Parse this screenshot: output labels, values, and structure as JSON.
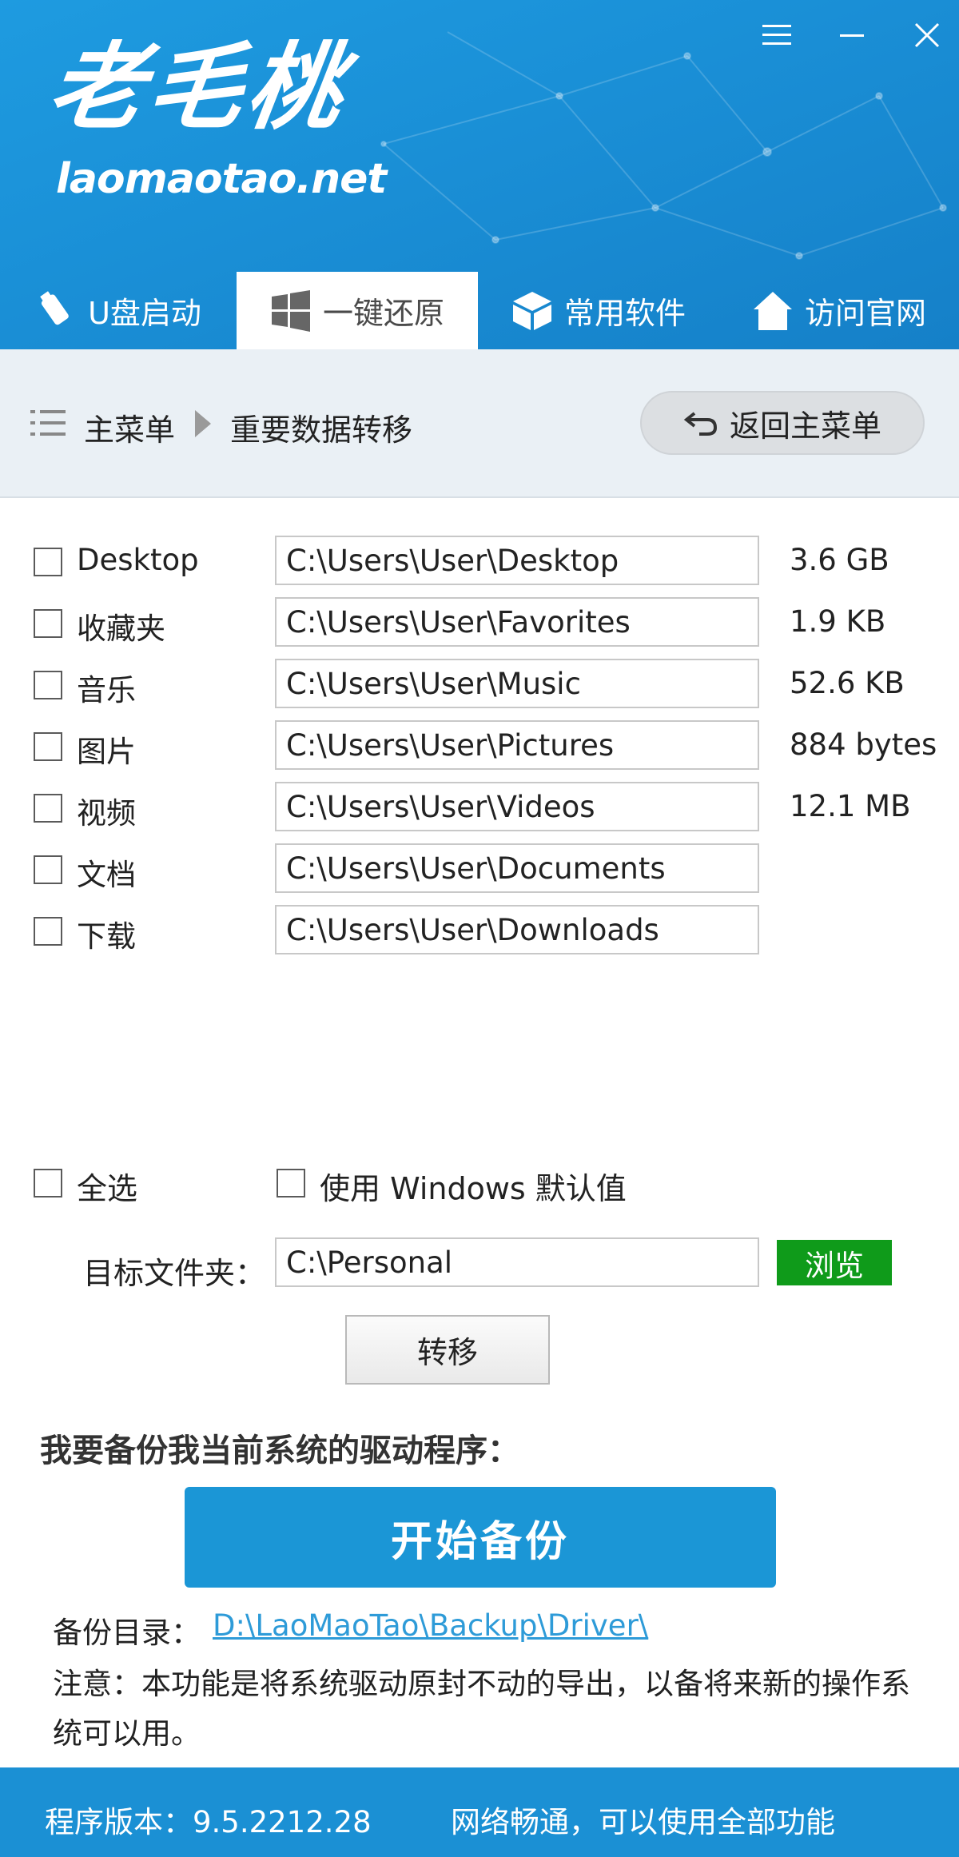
{
  "window": {
    "menu_icon": "hamburger-icon",
    "minimize_icon": "minimize-icon",
    "close_icon": "close-icon"
  },
  "brand": {
    "logo_cn": "老毛桃",
    "logo_en": "laomaotao.net",
    "header_color": "#1b8fd6"
  },
  "tabs": [
    {
      "label": "U盘启动",
      "icon": "usb-icon",
      "active": false
    },
    {
      "label": "一键还原",
      "icon": "windows-icon",
      "active": true
    },
    {
      "label": "常用软件",
      "icon": "box-icon",
      "active": false
    },
    {
      "label": "访问官网",
      "icon": "home-icon",
      "active": false
    }
  ],
  "breadcrumb": {
    "home": "主菜单",
    "current": "重要数据转移",
    "back_label": "返回主菜单"
  },
  "folders": [
    {
      "label": "Desktop",
      "path": "C:\\Users\\User\\Desktop",
      "size": "3.6 GB"
    },
    {
      "label": "收藏夹",
      "path": "C:\\Users\\User\\Favorites",
      "size": "1.9 KB"
    },
    {
      "label": "音乐",
      "path": "C:\\Users\\User\\Music",
      "size": "52.6 KB"
    },
    {
      "label": "图片",
      "path": "C:\\Users\\User\\Pictures",
      "size": "884 bytes"
    },
    {
      "label": "视频",
      "path": "C:\\Users\\User\\Videos",
      "size": "12.1 MB"
    },
    {
      "label": "文档",
      "path": "C:\\Users\\User\\Documents",
      "size": ""
    },
    {
      "label": "下载",
      "path": "C:\\Users\\User\\Downloads",
      "size": ""
    }
  ],
  "options": {
    "select_all": "全选",
    "use_default": "使用 Windows 默认值"
  },
  "target": {
    "label": "目标文件夹：",
    "value": "C:\\Personal",
    "browse": "浏览",
    "browse_color": "#0f9b1a"
  },
  "move_button": "转移",
  "driver_backup": {
    "title": "我要备份我当前系统的驱动程序：",
    "start_button": "开始备份",
    "dir_label": "备份目录：",
    "dir_value": "D:\\LaoMaoTao\\Backup\\Driver\\",
    "note": "注意：本功能是将系统驱动原封不动的导出，以备将来新的操作系统可以用。"
  },
  "status": {
    "version": "程序版本：9.5.2212.28",
    "network": "网络畅通，可以使用全部功能"
  }
}
